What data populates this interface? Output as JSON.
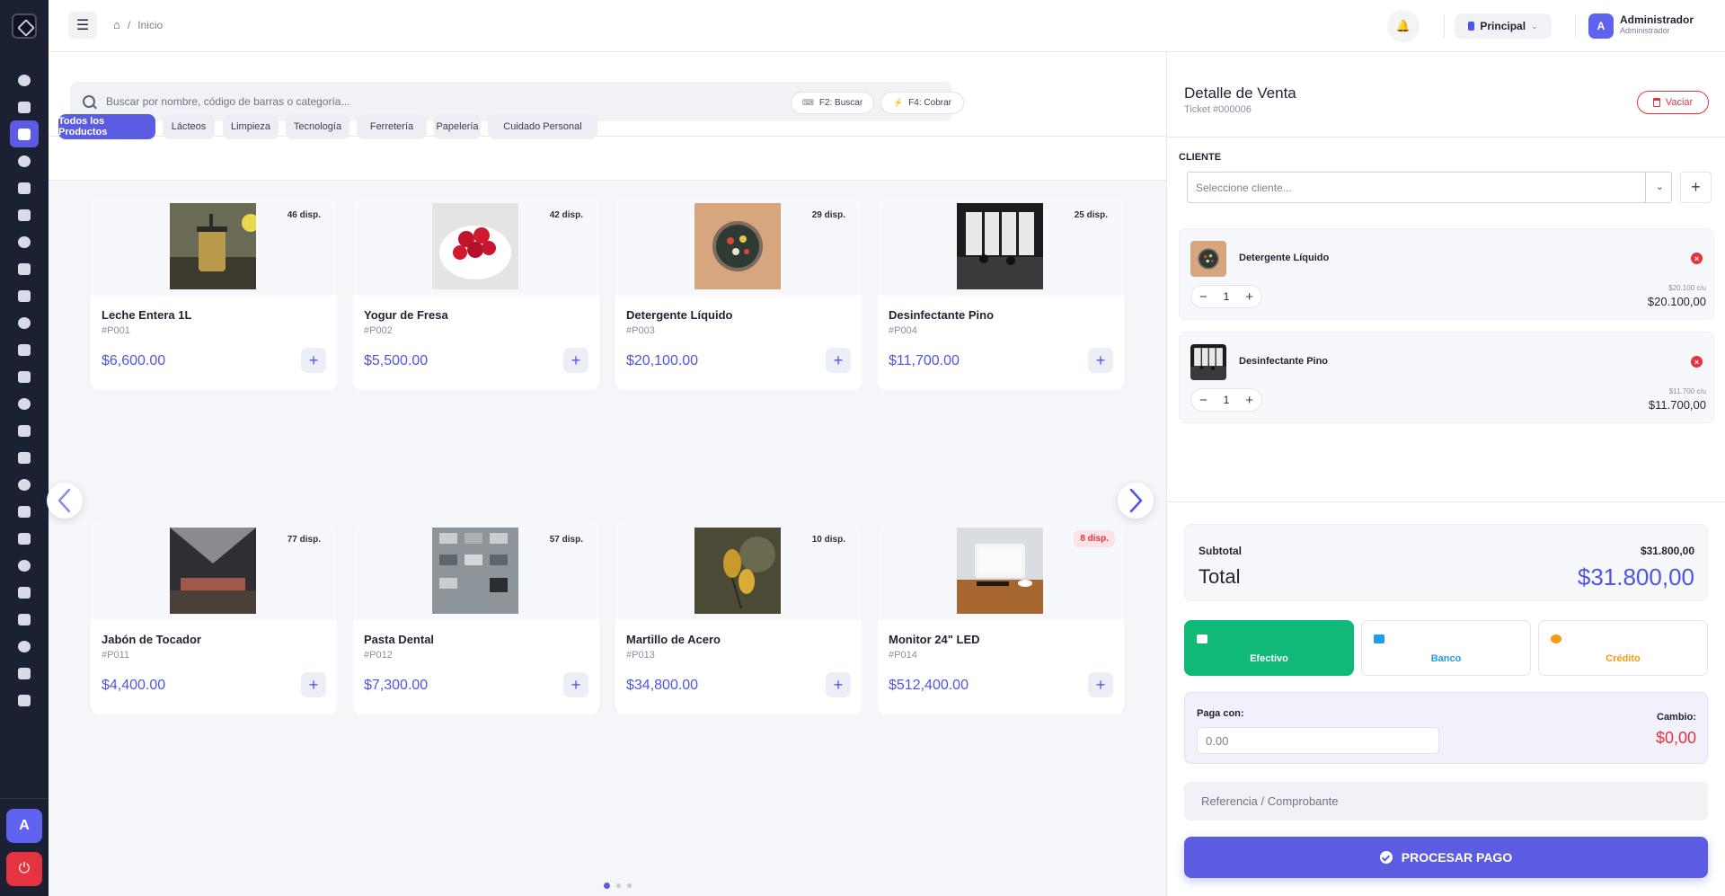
{
  "header": {
    "breadcrumb": [
      "Inicio"
    ],
    "separator": "/",
    "branch": "Principal",
    "user": {
      "initial": "A",
      "name": "Administrador",
      "role": "Administrador"
    }
  },
  "sidebar": {
    "icons": [
      "dashboard-icon",
      "chart-pie-icon",
      "pos-icon",
      "document-icon",
      "report-icon",
      "hand-icon",
      "file-icon",
      "money-icon",
      "wallet-icon",
      "tag-icon",
      "warehouse-icon",
      "transfer-icon",
      "cart-icon",
      "truck-icon",
      "exchange-icon",
      "cash-icon",
      "label-icon",
      "clipboard-check-icon",
      "users-icon",
      "user-cog-icon",
      "calculator-icon",
      "history-icon",
      "file-text-icon",
      "archive-icon"
    ],
    "active_index": 2,
    "avatar_initial": "A",
    "power_icon": "⏻"
  },
  "search": {
    "placeholder": "Buscar por nombre, código de barras o categoría...",
    "shortcut_search": "F2: Buscar",
    "shortcut_checkout": "F4: Cobrar"
  },
  "categories": [
    "Todos los Productos",
    "Lácteos",
    "Limpieza",
    "Tecnología",
    "Ferretería",
    "Papelería",
    "Cuidado Personal"
  ],
  "products": [
    {
      "name": "Leche Entera 1L",
      "code": "#P001",
      "price": "$6,600.00",
      "stock": "46 disp.",
      "low": false
    },
    {
      "name": "Yogur de Fresa",
      "code": "#P002",
      "price": "$5,500.00",
      "stock": "42 disp.",
      "low": false
    },
    {
      "name": "Detergente Líquido",
      "code": "#P003",
      "price": "$20,100.00",
      "stock": "29 disp.",
      "low": false
    },
    {
      "name": "Desinfectante Pino",
      "code": "#P004",
      "price": "$11,700.00",
      "stock": "25 disp.",
      "low": false
    },
    {
      "name": "Jabón de Tocador",
      "code": "#P011",
      "price": "$4,400.00",
      "stock": "77 disp.",
      "low": false
    },
    {
      "name": "Pasta Dental",
      "code": "#P012",
      "price": "$7,300.00",
      "stock": "57 disp.",
      "low": false
    },
    {
      "name": "Martillo de Acero",
      "code": "#P013",
      "price": "$34,800.00",
      "stock": "10 disp.",
      "low": false
    },
    {
      "name": "Monitor 24\" LED",
      "code": "#P014",
      "price": "$512,400.00",
      "stock": "8 disp.",
      "low": true
    }
  ],
  "sale": {
    "title": "Detalle de Venta",
    "ticket": "Ticket #000006",
    "clear_label": "Vaciar",
    "client_label": "CLIENTE",
    "client_placeholder": "Seleccione cliente...",
    "items": [
      {
        "name": "Detergente Líquido",
        "qty": "1",
        "unit": "$20.100 c/u",
        "total": "$20.100,00"
      },
      {
        "name": "Desinfectante Pino",
        "qty": "1",
        "unit": "$11.700 c/u",
        "total": "$11.700,00"
      }
    ],
    "subtotal_label": "Subtotal",
    "subtotal": "$31.800,00",
    "total_label": "Total",
    "total": "$31.800,00",
    "methods": {
      "cash": "Efectivo",
      "bank": "Banco",
      "credit": "Crédito"
    },
    "pay_with_label": "Paga con:",
    "pay_with_placeholder": "0.00",
    "change_label": "Cambio:",
    "change": "$0,00",
    "reference_placeholder": "Referencia / Comprobante",
    "process_label": "PROCESAR PAGO"
  },
  "colors": {
    "accent": "#5b5ce2",
    "sidebar": "#1b2133",
    "success": "#10b978",
    "danger": "#e5343f",
    "info": "#1e9ee8",
    "warning": "#f39c12"
  }
}
